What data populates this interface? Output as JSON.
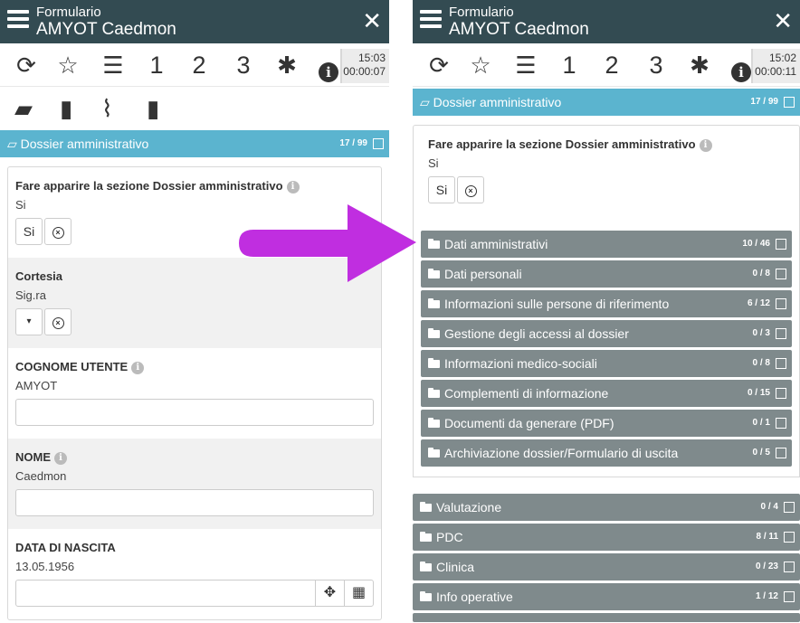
{
  "colors": {
    "header_bg": "#334b52",
    "section_bg": "#5bb4cf",
    "subsection_bg": "#7f8a8c",
    "arrow": "#c02ee0"
  },
  "left": {
    "header": {
      "title1": "Formulario",
      "title2": "AMYOT Caedmon"
    },
    "toolbar": {
      "n1": "1",
      "n2": "2",
      "n3": "3",
      "time": "15:03",
      "elapsed": "00:00:07"
    },
    "section": {
      "label": "Dossier amministrativo",
      "count": "17 / 99"
    },
    "fields": {
      "show_section": {
        "label": "Fare apparire la sezione Dossier amministrativo",
        "value": "Si",
        "button": "Si"
      },
      "cortesia": {
        "label": "Cortesia",
        "value": "Sig.ra"
      },
      "cognome": {
        "label": "COGNOME UTENTE",
        "value": "AMYOT"
      },
      "nome": {
        "label": "NOME",
        "value": "Caedmon"
      },
      "nascita": {
        "label": "DATA DI NASCITA",
        "value": "13.05.1956"
      }
    }
  },
  "right": {
    "header": {
      "title1": "Formulario",
      "title2": "AMYOT Caedmon"
    },
    "toolbar": {
      "n1": "1",
      "n2": "2",
      "n3": "3",
      "time": "15:02",
      "elapsed": "00:00:11"
    },
    "section": {
      "label": "Dossier amministrativo",
      "count": "17 / 99"
    },
    "show_section": {
      "label": "Fare apparire la sezione Dossier amministrativo",
      "value": "Si",
      "button": "Si"
    },
    "subsections": [
      {
        "label": "Dati amministrativi",
        "count": "10 / 46"
      },
      {
        "label": "Dati personali",
        "count": "0 / 8"
      },
      {
        "label": "Informazioni sulle persone di riferimento",
        "count": "6 / 12"
      },
      {
        "label": "Gestione degli accessi al dossier",
        "count": "0 / 3"
      },
      {
        "label": "Informazioni medico-sociali",
        "count": "0 / 8"
      },
      {
        "label": "Complementi di informazione",
        "count": "0 / 15"
      },
      {
        "label": "Documenti da generare (PDF)",
        "count": "0 / 1"
      },
      {
        "label": "Archiviazione dossier/Formulario di uscita",
        "count": "0 / 5"
      }
    ],
    "sections": [
      {
        "label": "Valutazione",
        "count": "0 / 4"
      },
      {
        "label": "PDC",
        "count": "8 / 11"
      },
      {
        "label": "Clinica",
        "count": "0 / 23"
      },
      {
        "label": "Info operative",
        "count": "1 / 12"
      }
    ]
  }
}
